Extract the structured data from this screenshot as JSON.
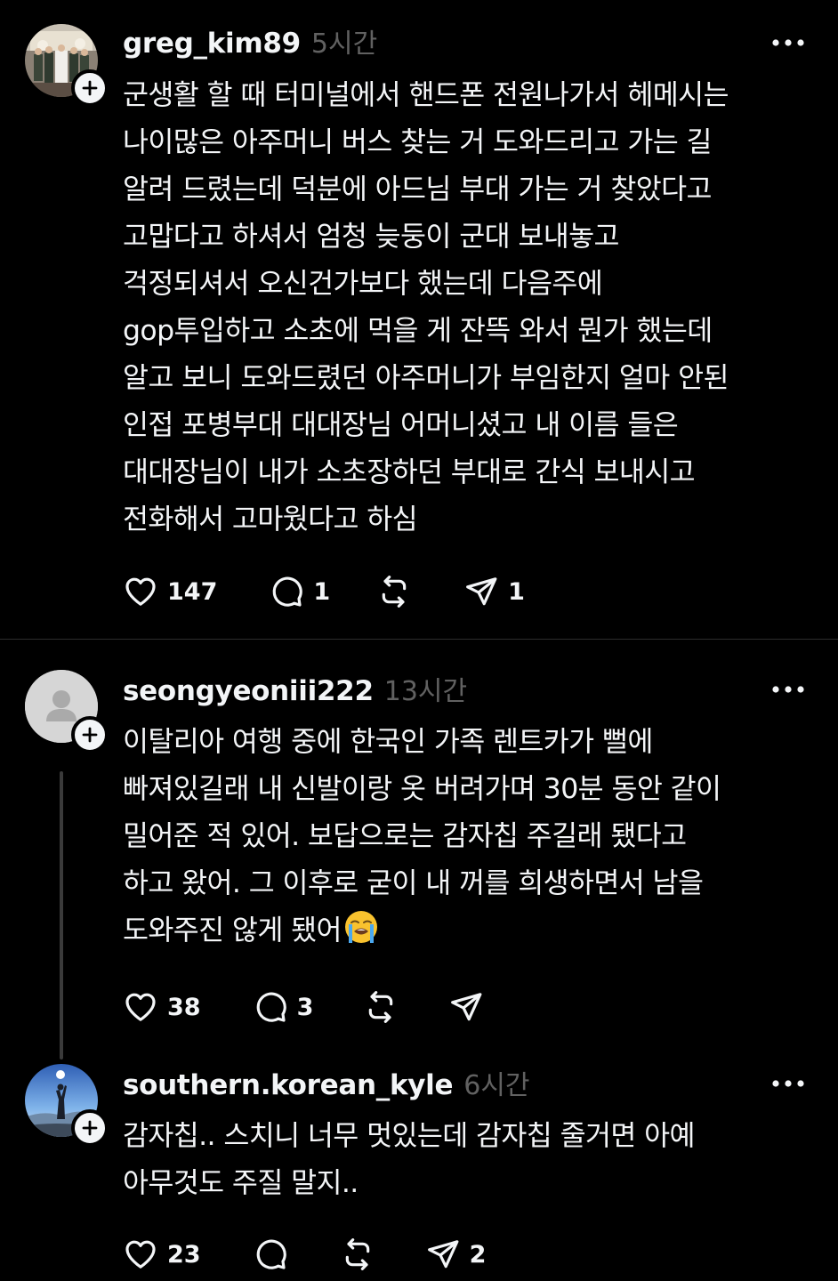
{
  "posts": [
    {
      "username": "greg_kim89",
      "time": "5시간",
      "lines": [
        "군생활 할 때 터미널에서 핸드폰 전원나가서 헤메시는",
        "나이많은 아주머니 버스 찾는 거 도와드리고 가는 길",
        "알려 드렸는데 덕분에 아드님 부대 가는 거 찾았다고",
        "고맙다고 하셔서 엄청 늦둥이 군대 보내놓고",
        "걱정되셔서 오신건가보다 했는데 다음주에",
        "gop투입하고 소초에 먹을 게 잔뜩 와서 뭔가 했는데",
        "알고 보니 도와드렸던 아주머니가 부임한지 얼마 안된",
        "인접 포병부대 대대장님 어머니셨고 내 이름 들은",
        "대대장님이 내가 소초장하던 부대로 간식 보내시고",
        "전화해서 고마웠다고 하심"
      ],
      "likes": "147",
      "replies": "1",
      "shares": "1"
    },
    {
      "username": "seongyeoniii222",
      "time": "13시간",
      "lines": [
        "이탈리아 여행 중에 한국인 가족 렌트카가 뻘에",
        "빠져있길래 내 신발이랑 옷 버려가며 30분 동안 같이",
        "밀어준 적 있어. 보답으로는 감자칩 주길래 됐다고",
        "하고 왔어. 그 이후로 굳이 내 꺼를 희생하면서 남을",
        "도와주진 않게 됐어"
      ],
      "emoji": "loudly-crying-face",
      "likes": "38",
      "replies": "3"
    },
    {
      "username": "southern.korean_kyle",
      "time": "6시간",
      "lines": [
        "감자칩.. 스치니 너무 멋있는데 감자칩 줄거면 아예",
        "아무것도 주질 말지.."
      ],
      "likes": "23",
      "shares": "2"
    }
  ],
  "colors": {
    "background": "#000000",
    "text": "#f3f5f7",
    "muted": "#616161",
    "divider": "#2d2d2d"
  }
}
